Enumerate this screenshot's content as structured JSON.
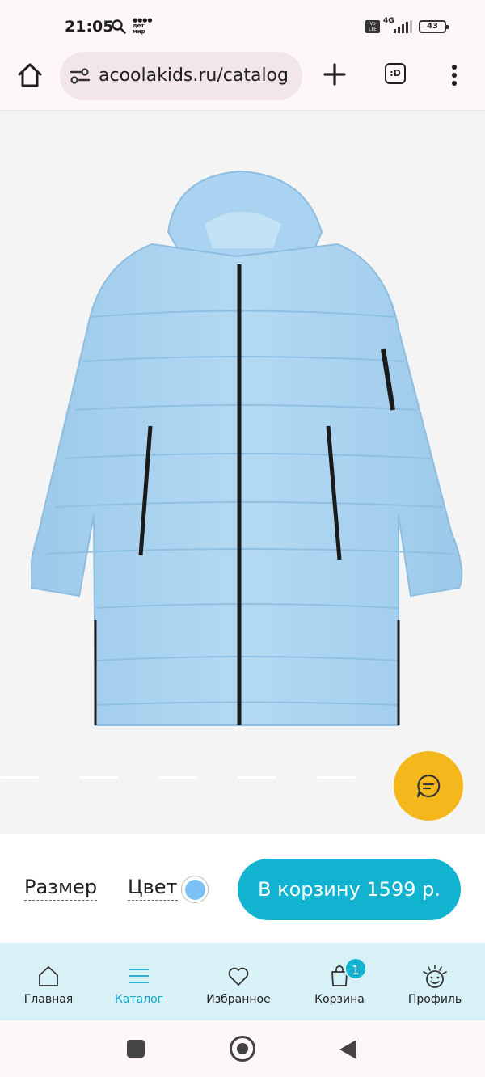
{
  "status_bar": {
    "time": "21:05",
    "brand_top": "●●●●",
    "brand_mid": "дет",
    "brand_bot": "мир",
    "volte": "Vo LTE",
    "network": "4G",
    "battery": "43"
  },
  "browser": {
    "url": "acoolakids.ru/catalog",
    "tabs_label": ":D",
    "icons": [
      "home-icon",
      "tune-icon",
      "plus-icon",
      "tabs-icon",
      "more-vert-icon"
    ]
  },
  "product": {
    "image": "light-blue-puffer-coat",
    "slides": 6,
    "active_slide": 0,
    "chat_icon": "chat-bubble-icon",
    "accent_yellow": "#f5b81c"
  },
  "actions": {
    "size_label": "Размер",
    "color_label": "Цвет",
    "color_value": "#7cc1f5",
    "cart_button": "В корзину 1599 р.",
    "accent": "#12b2d1"
  },
  "bottom_nav": {
    "items": [
      {
        "label": "Главная",
        "icon": "home-outline-icon"
      },
      {
        "label": "Каталог",
        "icon": "catalog-lines-icon"
      },
      {
        "label": "Избранное",
        "icon": "heart-icon"
      },
      {
        "label": "Корзина",
        "icon": "shopping-bag-icon",
        "badge": "1"
      },
      {
        "label": "Профиль",
        "icon": "smiley-sun-icon"
      }
    ],
    "active_index": 1
  }
}
